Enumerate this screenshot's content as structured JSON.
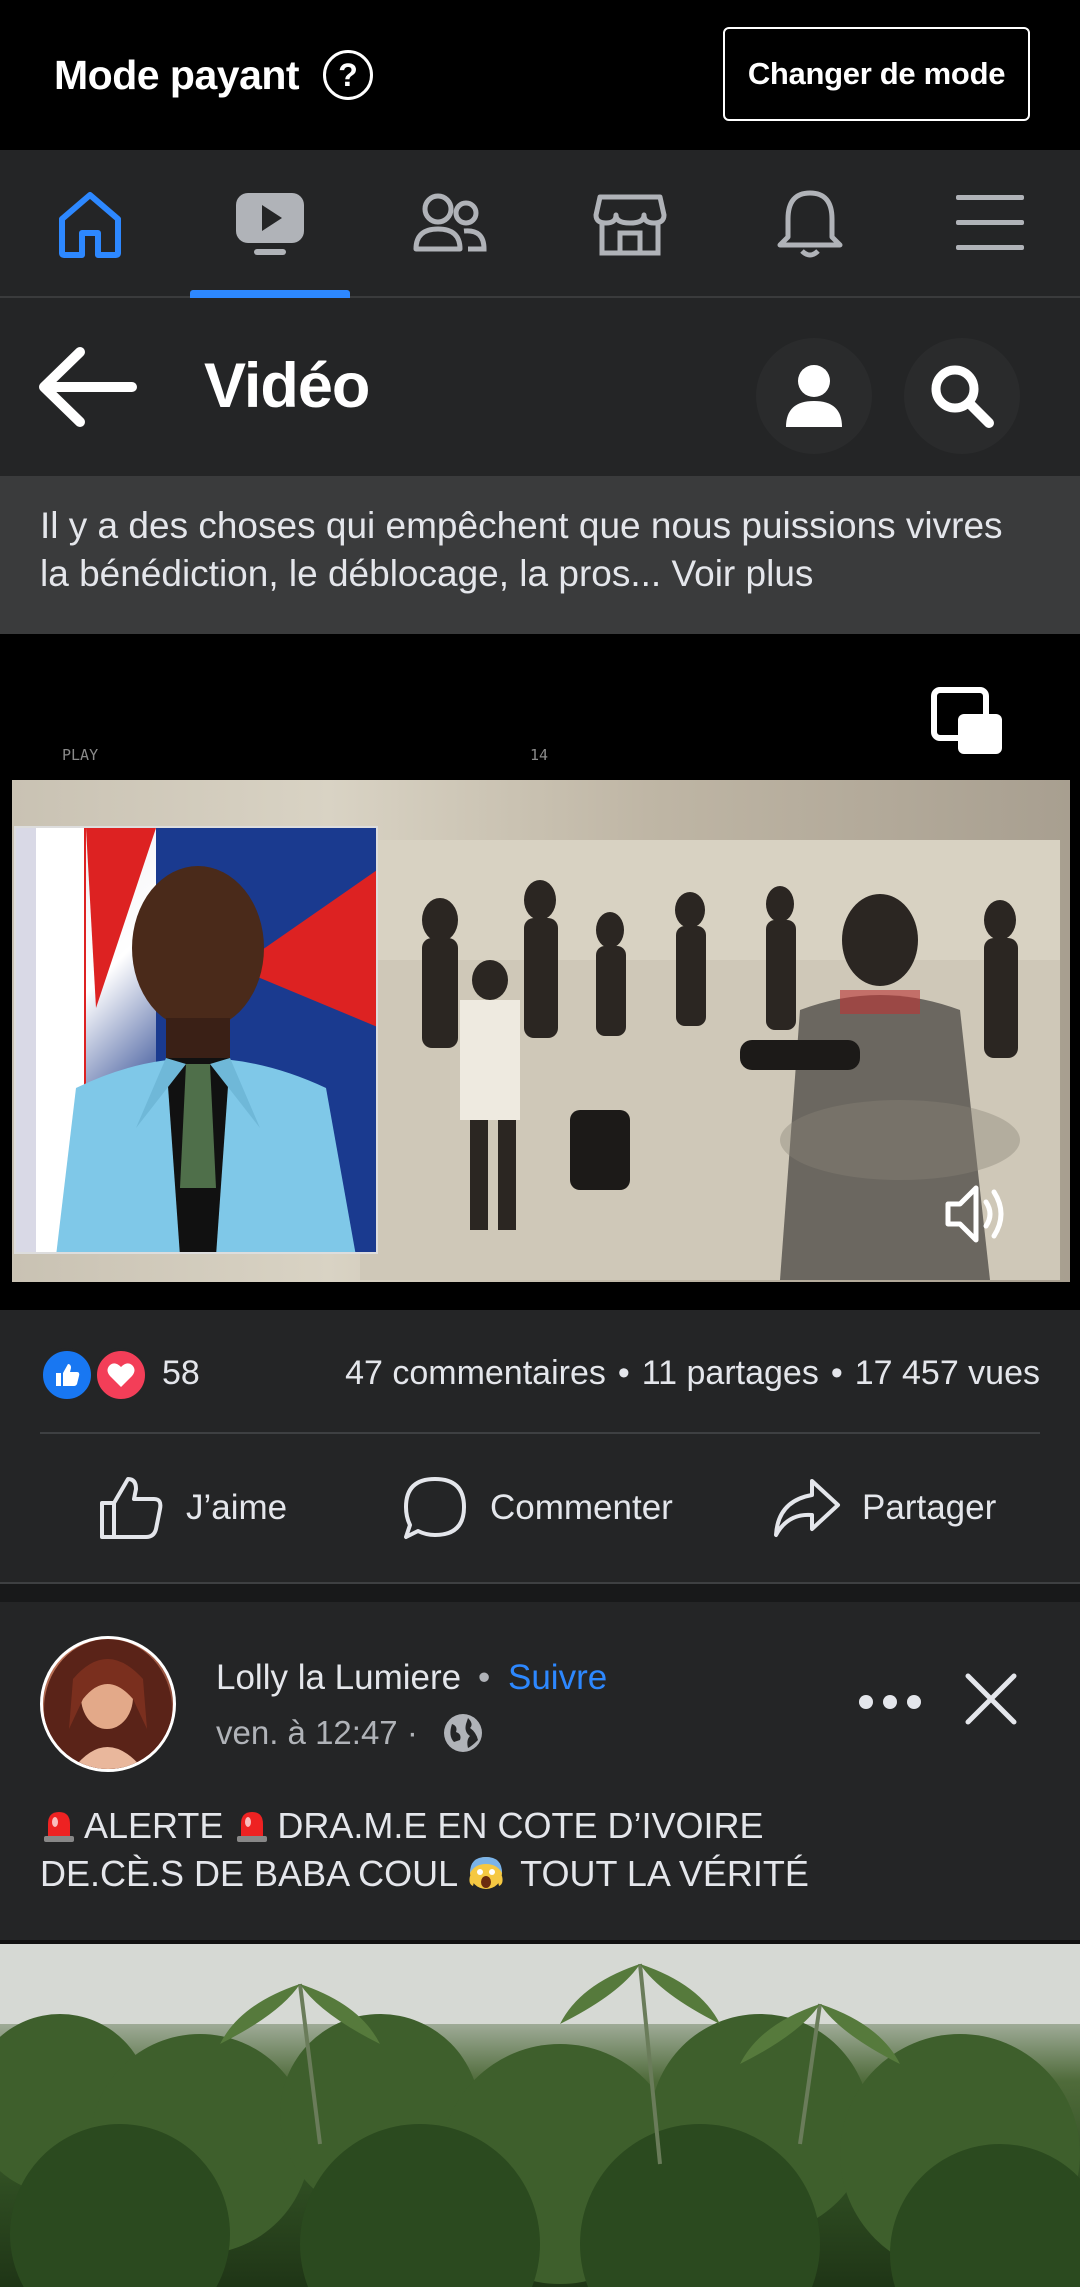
{
  "mode_bar": {
    "title": "Mode payant",
    "help_icon": "question-circle-icon",
    "switch_button": "Changer de mode"
  },
  "nav": {
    "items": [
      {
        "name": "home",
        "icon": "home-icon",
        "active": true
      },
      {
        "name": "video",
        "icon": "video-icon",
        "selected": true
      },
      {
        "name": "friends",
        "icon": "friends-icon"
      },
      {
        "name": "marketplace",
        "icon": "marketplace-icon"
      },
      {
        "name": "notifications",
        "icon": "bell-icon"
      },
      {
        "name": "menu",
        "icon": "hamburger-menu-icon"
      }
    ],
    "accent": "#2d88ff"
  },
  "header": {
    "title": "Vidéo"
  },
  "post1": {
    "caption": "Il y a des choses qui empêchent que nous puissions vivres la bénédiction, le déblocage, la pros...",
    "see_more": "Voir plus",
    "video_overlay": {
      "left": "PLAY",
      "center": "14"
    },
    "reactions": {
      "count": "58"
    },
    "comments": "47 commentaires",
    "shares": "11 partages",
    "views": "17 457 vues",
    "actions": {
      "like": "J’aime",
      "comment": "Commenter",
      "share": "Partager"
    }
  },
  "post2": {
    "author": "Lolly la Lumiere",
    "follow": "Suivre",
    "time": "ven. à 12:47",
    "text_line1": "ALERTE",
    "text_line1b": "DRA.M.E EN COTE D’IVOIRE",
    "text_line2": "DE.CÈ.S DE BABA COUL",
    "text_line2b": "TOUT LA VÉRITÉ"
  },
  "colors": {
    "background": "#242526",
    "topbar": "#000000",
    "caption_bg": "#3a3b3c",
    "link_blue": "#2d88ff",
    "like_blue": "#1877f2",
    "love_red": "#f33e58"
  }
}
